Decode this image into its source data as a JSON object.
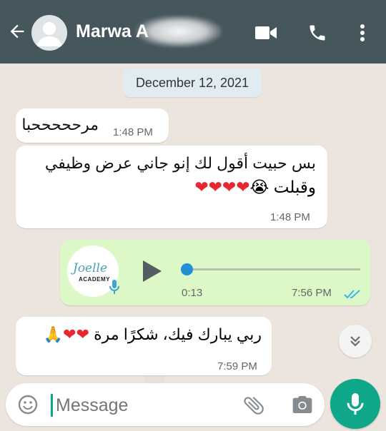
{
  "header": {
    "contact_name": "Marwa A Aloolfi",
    "contact_name_visible": "Marwa A",
    "icons": [
      "back-arrow-icon",
      "avatar-icon",
      "video-call-icon",
      "phone-icon",
      "more-options-icon"
    ],
    "color": "#46565d"
  },
  "chat": {
    "date_label": "December 12, 2021",
    "messages": [
      {
        "text": "مرحححححبا",
        "time": "1:48 PM",
        "direction": "incoming"
      },
      {
        "line1": "بس حبيت أقول لك إنو جاني عرض وظيفي",
        "line2": "وقبلت",
        "emoji": "😭",
        "hearts": "❤❤❤❤",
        "time": "1:48 PM",
        "direction": "incoming"
      },
      {
        "type": "voice",
        "duration": "0:13",
        "time": "7:56 PM",
        "status": "read",
        "avatar_text1": "Joelle",
        "avatar_text2": "ACADEMY",
        "direction": "outgoing"
      },
      {
        "text": "ربي يبارك فيك، شكرًا مرة",
        "hearts": "❤❤",
        "emoji": "🙏",
        "time": "7:59 PM",
        "direction": "incoming"
      }
    ]
  },
  "composer": {
    "placeholder": "Message",
    "icons": [
      "emoji-icon",
      "attach-icon",
      "camera-icon",
      "mic-icon"
    ],
    "accent": "#0fa78a"
  },
  "scroll_down": {
    "icon": "double-chevron-down-icon"
  }
}
